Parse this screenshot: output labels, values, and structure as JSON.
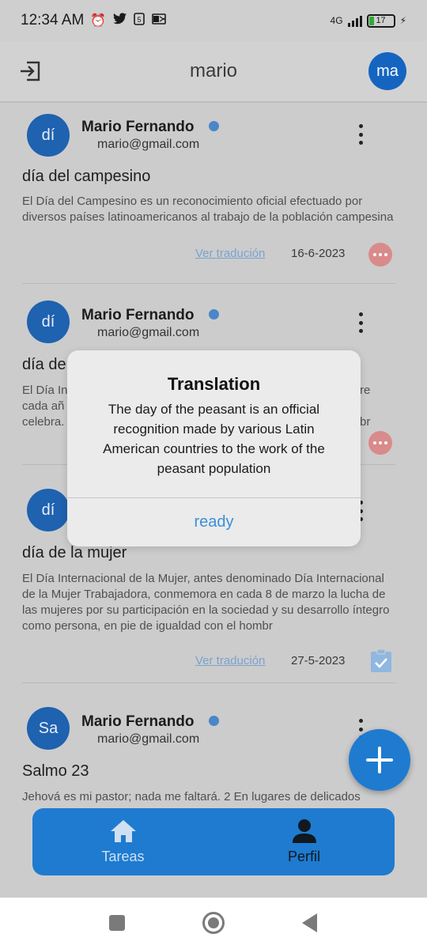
{
  "status_bar": {
    "time": "12:34 AM",
    "network": "4G",
    "battery": "17"
  },
  "app_bar": {
    "title": "mario",
    "avatar_initials": "ma"
  },
  "posts": [
    {
      "avatar": "dí",
      "name": "Mario Fernando",
      "email": "mario@gmail.com",
      "title": "día del campesino",
      "body": "El Día del Campesino es un reconocimiento oficial efectuado por diversos países latinoamericanos al trabajo de la población campesina",
      "link": "Ver tradución",
      "date": "16-6-2023",
      "status": "pending"
    },
    {
      "avatar": "dí",
      "name": "Mario Fernando",
      "email": "mario@gmail.com",
      "title": "día de",
      "body_lines": [
        "El Día In",
        "cada añ",
        "celebra."
      ],
      "body_right_lines": [
        "re",
        "",
        "br"
      ],
      "status": "pending"
    },
    {
      "avatar": "dí",
      "title": "día de la mujer",
      "body": "El Día Internacional de la Mujer, antes denominado Día Internacional de la Mujer Trabajadora,  conmemora en cada 8 de marzo la lucha de las mujeres por su participación en la sociedad y su desarrollo íntegro como persona, en pie de igualdad con el hombr",
      "link": "Ver tradución",
      "date": "27-5-2023",
      "status": "done"
    },
    {
      "avatar": "Sa",
      "name": "Mario Fernando",
      "email": "mario@gmail.com",
      "title": "Salmo 23",
      "body": "Jehová es mi pastor; nada me faltará.  2 En lugares de delicados"
    }
  ],
  "dialog": {
    "title": "Translation",
    "message": "The day of the peasant is an official recognition made by various Latin American countries to the work of the peasant population",
    "button": "ready"
  },
  "bottom_nav": {
    "items": [
      {
        "label": "Tareas",
        "icon": "home-icon"
      },
      {
        "label": "Perfil",
        "icon": "person-icon"
      }
    ]
  },
  "colors": {
    "primary": "#1e7bd0",
    "avatar": "#1e62b0",
    "pending": "#d98a8a",
    "done": "#8fb7e0",
    "dialog_button": "#3d8fd8"
  }
}
